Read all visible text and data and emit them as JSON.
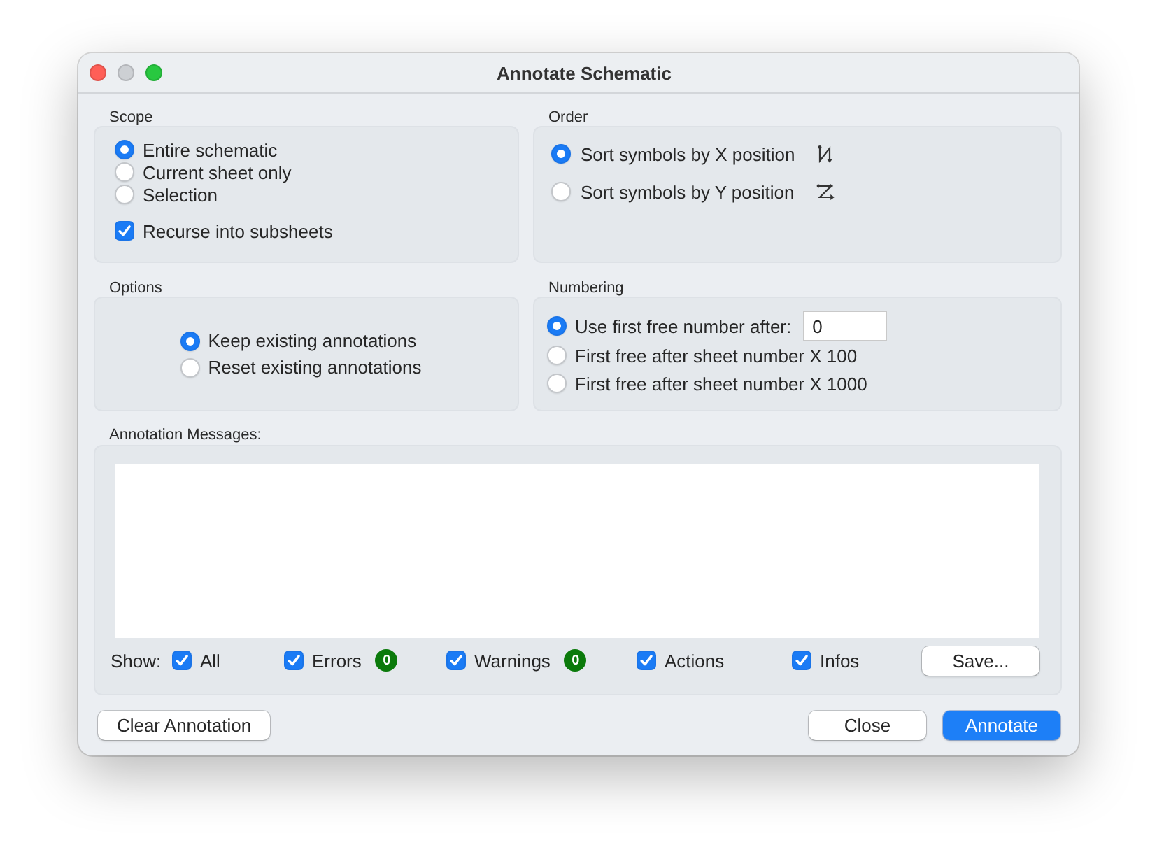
{
  "window": {
    "title": "Annotate Schematic",
    "controls": [
      {
        "kind": "close",
        "disabled": false
      },
      {
        "kind": "minimize",
        "disabled": true
      },
      {
        "kind": "zoom",
        "disabled": false
      }
    ]
  },
  "scope": {
    "label": "Scope",
    "options": [
      {
        "label": "Entire schematic",
        "selected": true
      },
      {
        "label": "Current sheet only",
        "selected": false
      },
      {
        "label": "Selection",
        "selected": false
      }
    ],
    "recurse": {
      "label": "Recurse into subsheets",
      "checked": true
    }
  },
  "order": {
    "label": "Order",
    "options": [
      {
        "label": "Sort symbols by X position",
        "selected": true
      },
      {
        "label": "Sort symbols by Y position",
        "selected": false
      }
    ]
  },
  "options": {
    "label": "Options",
    "choices": [
      {
        "label": "Keep existing annotations",
        "selected": true
      },
      {
        "label": "Reset existing annotations",
        "selected": false
      }
    ]
  },
  "numbering": {
    "label": "Numbering",
    "choices": [
      {
        "label": "Use first free number after:",
        "selected": true,
        "value": "0"
      },
      {
        "label": "First free after sheet number X 100",
        "selected": false
      },
      {
        "label": "First free after sheet number X 1000",
        "selected": false
      }
    ]
  },
  "messages": {
    "label": "Annotation Messages:",
    "show_label": "Show:",
    "filters": [
      {
        "label": "All",
        "checked": true
      },
      {
        "label": "Errors",
        "checked": true,
        "count": "0"
      },
      {
        "label": "Warnings",
        "checked": true,
        "count": "0"
      },
      {
        "label": "Actions",
        "checked": true
      },
      {
        "label": "Infos",
        "checked": true
      }
    ],
    "save_button": "Save..."
  },
  "buttons": [
    {
      "label": "Clear Annotation",
      "default": false
    },
    {
      "label": "Close",
      "default": false
    },
    {
      "label": "Annotate",
      "default": true
    }
  ]
}
